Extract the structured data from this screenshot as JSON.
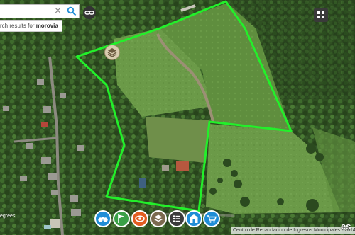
{
  "search": {
    "value": "",
    "placeholder": "",
    "clear_glyph": "×"
  },
  "results": {
    "prefix": "rch results for ",
    "term": "morovia"
  },
  "scale": {
    "label": "egrees"
  },
  "toolbar": {
    "items": [
      {
        "name": "binoculars-tool",
        "icon": "binoculars-icon",
        "color": "#1f8dd6"
      },
      {
        "name": "flag-tool",
        "icon": "flag-icon",
        "color": "#3aa047"
      },
      {
        "name": "eye-tool",
        "icon": "eye-icon",
        "color": "#e35d22"
      },
      {
        "name": "layers-tool",
        "icon": "layers-icon",
        "color": "#7b6a4f"
      },
      {
        "name": "list-tool",
        "icon": "list-icon",
        "color": "#3b3b3b"
      },
      {
        "name": "buildings-tool",
        "icon": "buildings-icon",
        "color": "#1f8dd6"
      },
      {
        "name": "cart-tool",
        "icon": "cart-icon",
        "color": "#1f8dd6"
      }
    ]
  },
  "attribution": {
    "text": "Centro de Recaudacion de Ingresos Municipales - 2014"
  },
  "logo": {
    "text": "es"
  },
  "colors": {
    "parcel_outline": "#22f02a",
    "search_accent": "#1f8dd6"
  },
  "icons": {
    "search": "search-icon",
    "clear": "close-icon",
    "share": "link-icon",
    "basemap_gallery": "grid-icon",
    "map_layers": "layers-icon"
  }
}
